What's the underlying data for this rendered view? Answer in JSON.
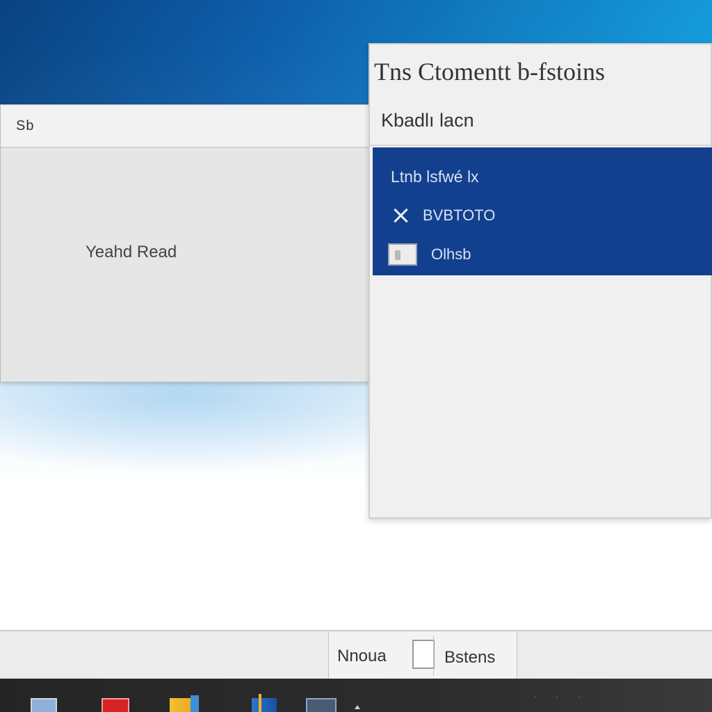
{
  "left_window": {
    "title": "Sb",
    "body_text": "Yeahd Read"
  },
  "right_panel": {
    "title": "Tns Ctomentt b-fstoins",
    "subtitle": "Kbadlı lacn",
    "menu_items": [
      {
        "label": "Ltnb lsfwé lx",
        "icon": ""
      },
      {
        "label": "BVBTOTO",
        "icon": "close-icon"
      },
      {
        "label": "Olhsb",
        "icon": "checkbox-icon"
      }
    ]
  },
  "lower_bar": {
    "name_label": "Nnoua",
    "settings_label": "Bstens"
  },
  "taskbar": {
    "apps": [
      "document-icon",
      "red-app-icon",
      "folder-icon",
      "book-icon",
      "app-window-icon"
    ],
    "tray_text": "· · ·"
  },
  "colors": {
    "menu_highlight": "#12408e",
    "window_bg": "#e6e6e6",
    "panel_bg": "#f0f0f0",
    "taskbar_bg": "#2c2c2c"
  }
}
